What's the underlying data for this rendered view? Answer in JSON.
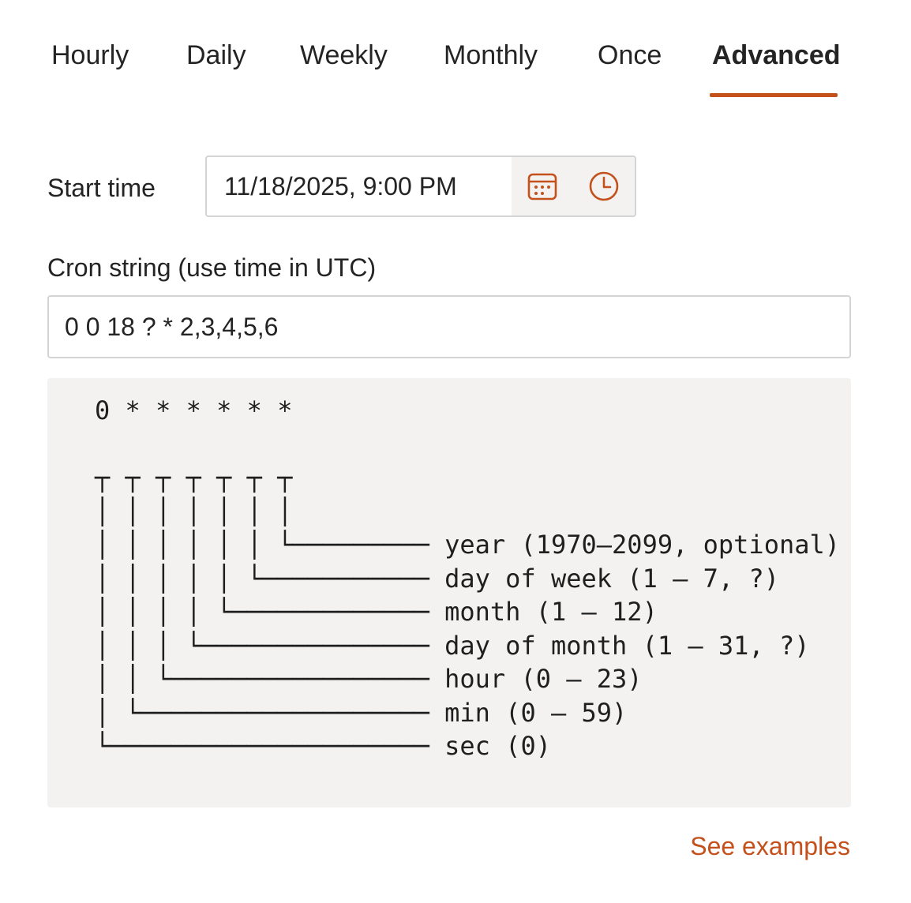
{
  "colors": {
    "accent": "#c4501c"
  },
  "tabs": [
    {
      "label": "Hourly",
      "active": false
    },
    {
      "label": "Daily",
      "active": false
    },
    {
      "label": "Weekly",
      "active": false
    },
    {
      "label": "Monthly",
      "active": false
    },
    {
      "label": "Once",
      "active": false
    },
    {
      "label": "Advanced",
      "active": true
    }
  ],
  "start_time": {
    "label": "Start time",
    "value": "11/18/2025, 9:00 PM",
    "calendar_icon": "calendar-icon",
    "clock_icon": "clock-icon"
  },
  "cron": {
    "label": "Cron string (use time in UTC)",
    "value": "0 0 18 ? * 2,3,4,5,6"
  },
  "help": {
    "diagram": "0 * * * * * *\n\n┬ ┬ ┬ ┬ ┬ ┬ ┬\n│ │ │ │ │ │ │\n│ │ │ │ │ │ └───────── year (1970–2099, optional)\n│ │ │ │ │ └─────────── day of week (1 – 7, ?)\n│ │ │ │ └───────────── month (1 – 12)\n│ │ │ └─────────────── day of month (1 – 31, ?)\n│ │ └───────────────── hour (0 – 23)\n│ └─────────────────── min (0 – 59)\n└───────────────────── sec (0)"
  },
  "links": {
    "see_examples": "See examples"
  }
}
